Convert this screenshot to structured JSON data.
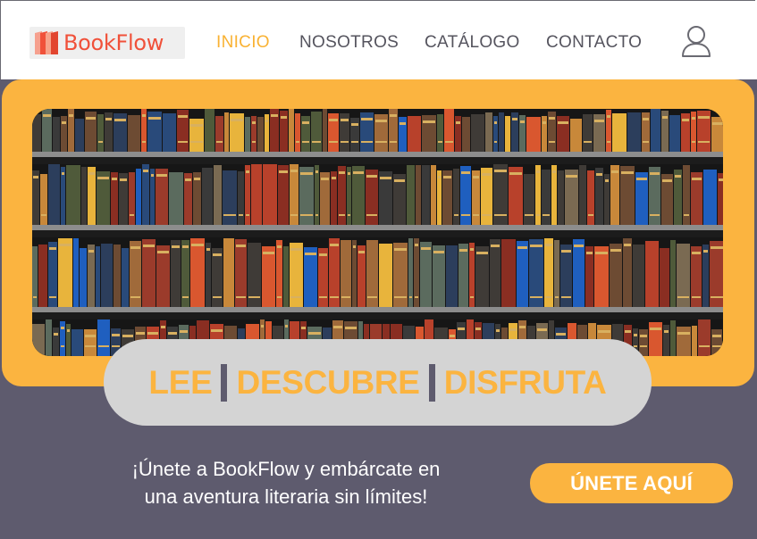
{
  "brand": {
    "name": "BookFlow"
  },
  "nav": {
    "items": [
      {
        "label": "INICIO",
        "active": true
      },
      {
        "label": "NOSOTROS",
        "active": false
      },
      {
        "label": "CATÁLOGO",
        "active": false
      },
      {
        "label": "CONTACTO",
        "active": false
      }
    ]
  },
  "hero": {
    "words": [
      "LEE",
      "DESCUBRE",
      "DISFRUTA"
    ],
    "tagline_line1": "¡Únete a BookFlow y embárcate en",
    "tagline_line2": "una aventura literaria sin límites!",
    "cta_label": "ÚNETE AQUÍ"
  },
  "colors": {
    "accent": "#fbb440",
    "brand_red": "#f0513a",
    "dark": "#5e5b6e",
    "pill": "#d4d4d4"
  },
  "icons": {
    "user": "user-icon",
    "logo": "bookflow-logo-icon"
  }
}
